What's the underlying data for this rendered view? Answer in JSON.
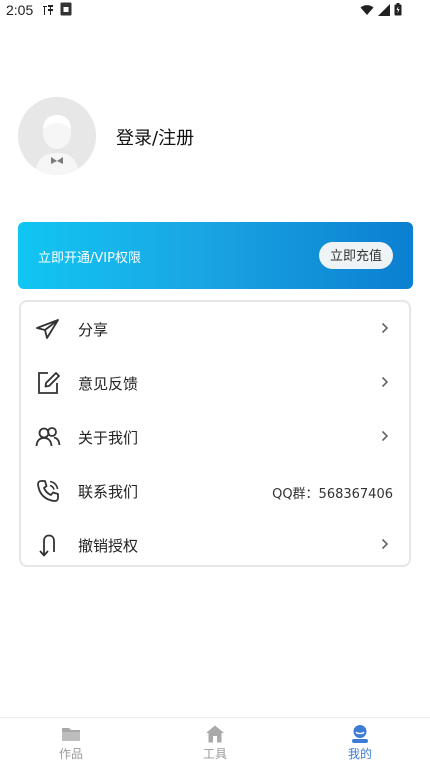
{
  "status_bar": {
    "time": "2:05"
  },
  "profile": {
    "login_label": "登录/注册"
  },
  "vip": {
    "text": "立即开通/VIP权限",
    "button_label": "立即充值"
  },
  "menu": {
    "items": [
      {
        "label": "分享",
        "icon": "paper-plane-icon"
      },
      {
        "label": "意见反馈",
        "icon": "edit-icon"
      },
      {
        "label": "关于我们",
        "icon": "users-icon"
      },
      {
        "label": "联系我们",
        "icon": "phone-icon",
        "extra": "QQ群：568367406"
      },
      {
        "label": "撤销授权",
        "icon": "revoke-icon"
      }
    ]
  },
  "bottom_nav": {
    "items": [
      {
        "label": "作品",
        "icon": "folder-icon",
        "active": false
      },
      {
        "label": "工具",
        "icon": "home-icon",
        "active": false
      },
      {
        "label": "我的",
        "icon": "person-icon",
        "active": true
      }
    ]
  },
  "colors": {
    "accent": "#3e7bd6",
    "banner_start": "#11c6f2",
    "banner_end": "#0b7fd0"
  }
}
